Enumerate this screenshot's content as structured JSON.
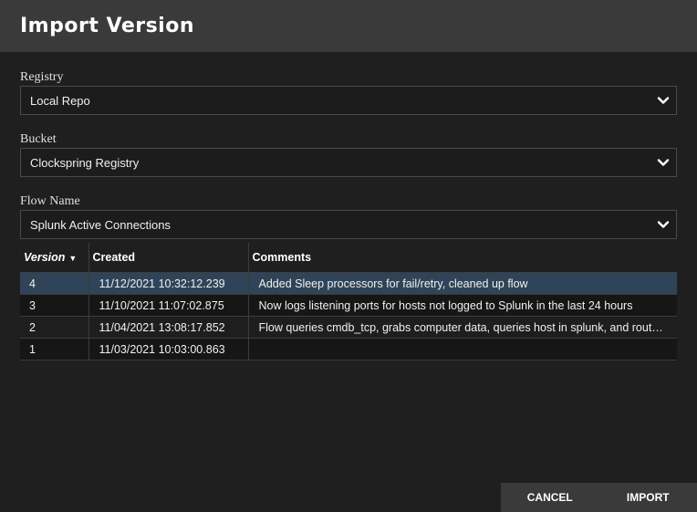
{
  "dialog": {
    "title": "Import Version"
  },
  "form": {
    "registry": {
      "label": "Registry",
      "value": "Local Repo"
    },
    "bucket": {
      "label": "Bucket",
      "value": "Clockspring Registry"
    },
    "flow_name": {
      "label": "Flow Name",
      "value": "Splunk Active Connections"
    }
  },
  "table": {
    "columns": [
      {
        "label": "Version",
        "sort": "descending"
      },
      {
        "label": "Created"
      },
      {
        "label": "Comments"
      }
    ],
    "rows": [
      {
        "version": "4",
        "created": "11/12/2021 10:32:12.239",
        "comments": "Added Sleep processors for fail/retry, cleaned up flow",
        "selected": true
      },
      {
        "version": "3",
        "created": "11/10/2021 11:07:02.875",
        "comments": "Now logs listening ports for hosts not logged to Splunk in the last 24 hours"
      },
      {
        "version": "2",
        "created": "11/04/2021 13:08:17.852",
        "comments": "Flow queries cmdb_tcp, grabs computer data, queries host in splunk, and routes on r..."
      },
      {
        "version": "1",
        "created": "11/03/2021 10:03:00.863",
        "comments": ""
      }
    ]
  },
  "footer": {
    "cancel_label": "CANCEL",
    "import_label": "IMPORT"
  },
  "colors": {
    "selected_row": "#2f4458",
    "titlebar": "#3a3a3a",
    "background": "#1f1f1f"
  },
  "icons": {
    "select_toggle": "chevron-down-icon",
    "sort_indicator": "sort-desc-icon"
  }
}
